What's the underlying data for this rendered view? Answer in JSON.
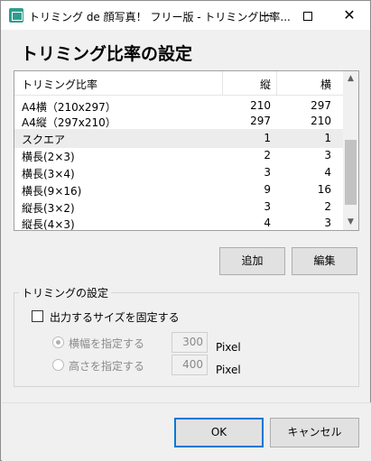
{
  "window": {
    "title": "トリミング de 顔写真！ フリー版 - トリミング比率...",
    "minimize_glyph": "",
    "maximize_glyph": "",
    "close_glyph": "✕"
  },
  "heading": "トリミング比率の設定",
  "ratio_list": {
    "columns": [
      "トリミング比率",
      "縦",
      "横"
    ],
    "rows": [
      {
        "name": "A4横（210x297）",
        "v": "210",
        "h": "297"
      },
      {
        "name": "A4縦（297x210）",
        "v": "297",
        "h": "210"
      },
      {
        "name": "スクエア",
        "v": "1",
        "h": "1"
      },
      {
        "name": "横長(2×3)",
        "v": "2",
        "h": "3"
      },
      {
        "name": "横長(3×4)",
        "v": "3",
        "h": "4"
      },
      {
        "name": "横長(9×16)",
        "v": "9",
        "h": "16"
      },
      {
        "name": "縦長(3×2)",
        "v": "3",
        "h": "2"
      },
      {
        "name": "縦長(4×3)",
        "v": "4",
        "h": "3"
      }
    ],
    "selected_index": 2
  },
  "buttons": {
    "add": "追加",
    "edit": "編集",
    "ok": "OK",
    "cancel": "キャンセル"
  },
  "trim_settings": {
    "group_title": "トリミングの設定",
    "fix_size_label": "出力するサイズを固定する",
    "fix_size_checked": false,
    "width_option": "横幅を指定する",
    "height_option": "高さを指定する",
    "width_value": "300",
    "height_value": "400",
    "unit": "Pixel"
  },
  "colors": {
    "accent": "#0078d7",
    "icon": "#2e9e8e"
  }
}
